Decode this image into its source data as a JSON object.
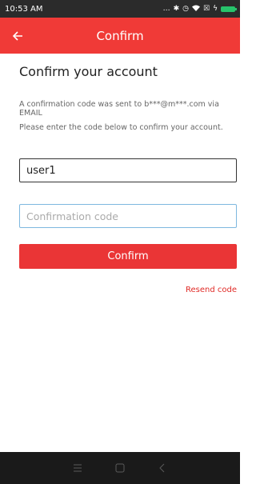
{
  "status_bar": {
    "time": "10:53 AM",
    "icons": [
      "more-dots-icon",
      "bluetooth-icon",
      "alarm-icon",
      "wifi-icon",
      "sim-icon",
      "charging-icon",
      "battery-icon"
    ],
    "battery_color": "#27c36b"
  },
  "app_bar": {
    "title": "Confirm",
    "back_icon": "arrow-left-icon",
    "color": "#f03a37"
  },
  "main": {
    "heading": "Confirm your account",
    "info": "A confirmation code was sent to b***@m***.com via EMAIL",
    "instructions": "Please enter the code below to confirm your account.",
    "username_value": "user1",
    "code_placeholder": "Confirmation code",
    "code_value": "",
    "confirm_label": "Confirm",
    "resend_label": "Resend code",
    "accent_color": "#ea3536"
  },
  "nav_bar": {
    "icons": [
      "menu-icon",
      "home-icon",
      "back-icon"
    ]
  }
}
